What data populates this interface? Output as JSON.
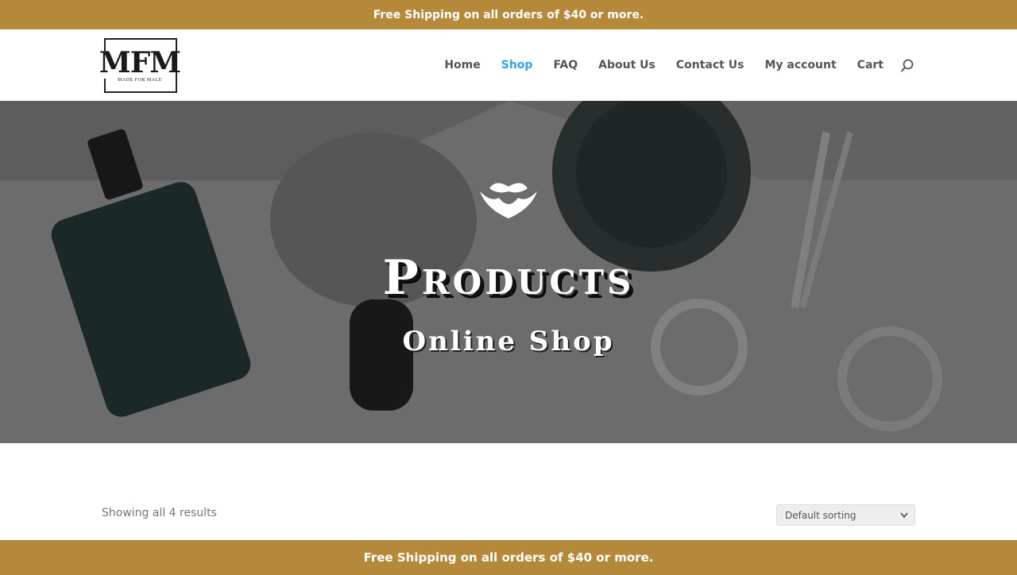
{
  "top_banner": {
    "text": "Free Shipping on all orders of $40 or more."
  },
  "logo": {
    "mark": "MFM",
    "tagline": "MADE FOR MALE"
  },
  "nav": {
    "items": [
      {
        "label": "Home"
      },
      {
        "label": "Shop"
      },
      {
        "label": "FAQ"
      },
      {
        "label": "About Us"
      },
      {
        "label": "Contact Us"
      },
      {
        "label": "My account"
      },
      {
        "label": "Cart"
      }
    ],
    "active": "Shop",
    "search_icon": "search-icon"
  },
  "hero": {
    "icon": "beard-mustache-icon",
    "title": "Products",
    "subtitle": "Online Shop"
  },
  "shop": {
    "results_text": "Showing all 4 results",
    "sort_selected": "Default sorting"
  },
  "bottom_banner": {
    "text": "Free Shipping on all orders of $40 or more."
  },
  "colors": {
    "banner": "#b5893a",
    "nav_active": "#2ea3f2",
    "nav_text": "#555555"
  }
}
